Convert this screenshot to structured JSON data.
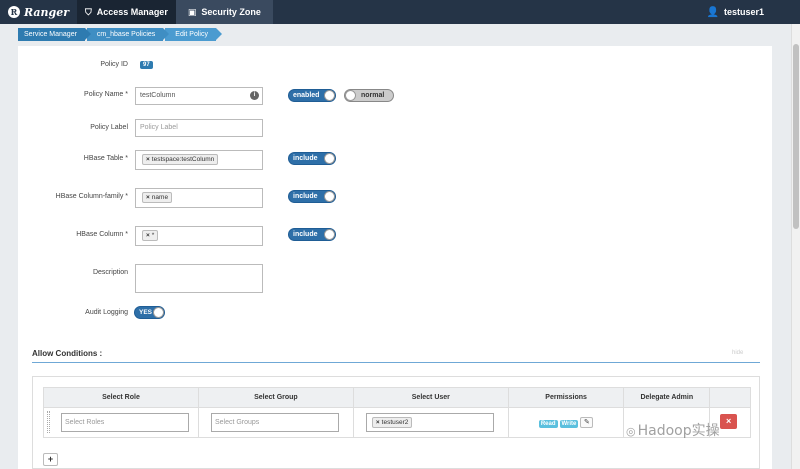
{
  "navbar": {
    "brand": "Ranger",
    "tabs": [
      {
        "label": "Access Manager",
        "icon": "shield-icon"
      },
      {
        "label": "Security Zone",
        "icon": "save-icon"
      }
    ],
    "user": "testuser1"
  },
  "breadcrumbs": [
    "Service Manager",
    "cm_hbase Policies",
    "Edit Policy"
  ],
  "form": {
    "policy_id_label": "Policy ID",
    "policy_id": "97",
    "policy_name_label": "Policy Name *",
    "policy_name": "testColumn",
    "enabled_toggle": "enabled",
    "normal_toggle": "normal",
    "policy_label_label": "Policy Label",
    "policy_label_placeholder": "Policy Label",
    "hbase_table_label": "HBase Table *",
    "hbase_table_tag": "testspace:testColumn",
    "column_family_label": "HBase Column-family *",
    "column_family_tag": "name",
    "column_label": "HBase Column *",
    "column_tag": "*",
    "include_label": "include",
    "description_label": "Description",
    "audit_label": "Audit Logging",
    "audit_toggle": "YES"
  },
  "allow_conditions": {
    "title": "Allow Conditions :",
    "hide_link": "hide",
    "headers": [
      "Select Role",
      "Select Group",
      "Select User",
      "Permissions",
      "Delegate Admin"
    ],
    "row": {
      "role_placeholder": "Select Roles",
      "group_placeholder": "Select Groups",
      "user_tag": "testuser2",
      "permissions": [
        "Read",
        "Write"
      ]
    },
    "add_label": "+",
    "delete_label": "×"
  },
  "watermark": "Hadoop实操"
}
